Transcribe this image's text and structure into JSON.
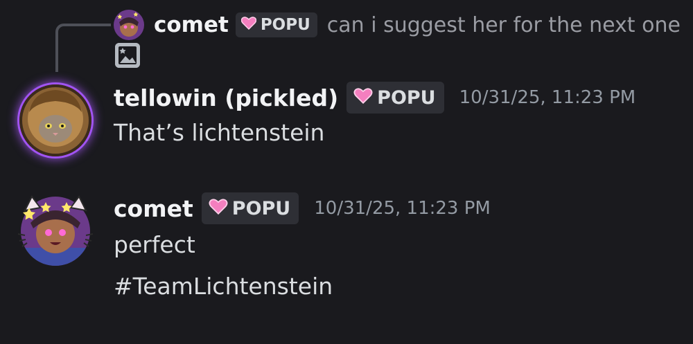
{
  "reply": {
    "author": "comet",
    "tag": "POPU",
    "text": "can i suggest her for the next one",
    "attachment_icon": "image-icon"
  },
  "messages": [
    {
      "author": "tellowin (pickled)",
      "tag": "POPU",
      "timestamp": "10/31/25, 11:23 PM",
      "lines": [
        "That’s lichtenstein"
      ]
    },
    {
      "author": "comet",
      "tag": "POPU",
      "timestamp": "10/31/25, 11:23 PM",
      "lines": [
        "perfect",
        "#TeamLichtenstein"
      ]
    }
  ],
  "colors": {
    "background": "#1a1a1e",
    "author": "#f2f3f5",
    "text": "#dbdee1",
    "muted": "#949ba4",
    "tag_bg": "#2e2f35",
    "heart": "#f47fbf",
    "avatar_glow": "#a154f2"
  }
}
